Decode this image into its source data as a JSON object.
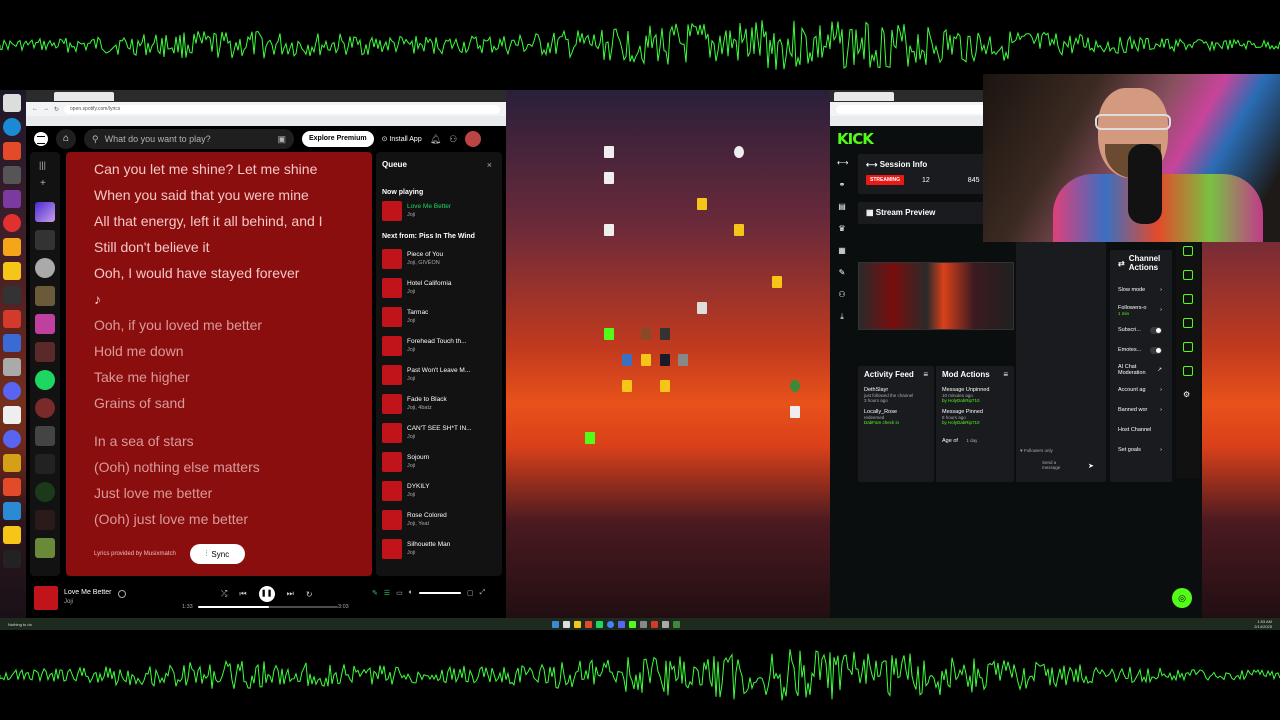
{
  "spotify": {
    "url": "open.spotify.com/lyrics",
    "search_placeholder": "What do you want to play?",
    "explore_premium": "Explore Premium",
    "install_app": "Install App",
    "lyrics": [
      "Can you let me shine? Let me shine",
      "When you said that you were mine",
      "All that energy, left it all behind, and I",
      "Still don't believe it",
      "Ooh, I would have stayed forever",
      "♪",
      "Ooh, if you loved me better",
      "Hold me down",
      "Take me higher",
      "Grains of sand",
      "In a sea of stars",
      "(Ooh) nothing else matters",
      "Just love me better",
      "(Ooh) just love me better"
    ],
    "lyrics_provider": "Lyrics provided by Musixmatch",
    "sync_label": "Sync",
    "queue": {
      "title": "Queue",
      "close": "×",
      "now_playing_label": "Now playing",
      "now_playing": {
        "title": "Love Me Better",
        "artist": "Joji"
      },
      "next_from_label": "Next from: Piss In The Wind",
      "items": [
        {
          "title": "Piece of You",
          "artist": "Joji, GIVĒON"
        },
        {
          "title": "Hotel California",
          "artist": "Joji"
        },
        {
          "title": "Tarmac",
          "artist": "Joji"
        },
        {
          "title": "Forehead Touch th...",
          "artist": "Joji"
        },
        {
          "title": "Past Won't Leave M...",
          "artist": "Joji"
        },
        {
          "title": "Fade to Black",
          "artist": "Joji, 4batz"
        },
        {
          "title": "CAN'T SEE SH*T IN...",
          "artist": "Joji"
        },
        {
          "title": "Sojourn",
          "artist": "Joji"
        },
        {
          "title": "DYKILY",
          "artist": "Joji"
        },
        {
          "title": "Rose Colored",
          "artist": "Joji, Yeat"
        },
        {
          "title": "Silhouette Man",
          "artist": "Joji"
        }
      ]
    },
    "player": {
      "title": "Love Me Better",
      "artist": "Joji",
      "elapsed": "1:33",
      "duration": "3:03",
      "progress": 0.51
    }
  },
  "kick": {
    "logo": "KICK",
    "session_info": "Session Info",
    "streaming_badge": "STREAMING",
    "viewers": "12",
    "followers": "845",
    "stream_preview": "Stream Preview",
    "activity_feed": "Activity Feed",
    "mod_actions": "Mod Actions",
    "channel_actions": "Channel Actions",
    "activity_items": [
      {
        "name": "DethSlayr",
        "sub": "just followed the channel",
        "time": "3 hours ago"
      },
      {
        "name": "Locally_Rose",
        "sub": "redeemed",
        "extra": "DabFam check in"
      }
    ],
    "mod_items": [
      {
        "name": "Message Unpinned",
        "by": "by HolyDabRip710",
        "time": "10 minutes ago"
      },
      {
        "name": "Message Pinned",
        "by": "by HolyDabRip710",
        "time": "8 hours ago"
      },
      {
        "name": "Age of",
        "time": "1 day"
      }
    ],
    "chat_followers_only": "Followers only",
    "chat_send": "Send a message",
    "channel_action_rows": [
      {
        "label": "Slow mode",
        "control": "chevron"
      },
      {
        "label": "Followers-o",
        "sub": "1 min",
        "control": "chevron"
      },
      {
        "label": "Subscri...",
        "control": "toggle"
      },
      {
        "label": "Emotes...",
        "control": "toggle"
      },
      {
        "label": "AI Chat Moderation",
        "control": "external"
      },
      {
        "label": "Account ag",
        "control": "chevron"
      },
      {
        "label": "Banned wor",
        "control": "chevron"
      },
      {
        "label": "Host Channel",
        "control": "none"
      },
      {
        "label": "Set goals",
        "control": "chevron"
      }
    ]
  },
  "taskbar": {
    "left_label": "Nothing to do",
    "time": "1:53 AM",
    "date": "2/14/2025"
  },
  "colors": {
    "spotify_green": "#1ed760",
    "kick_green": "#53fc18",
    "lyrics_bg": "#8b0e0e",
    "waveform": "#3cff3c"
  }
}
